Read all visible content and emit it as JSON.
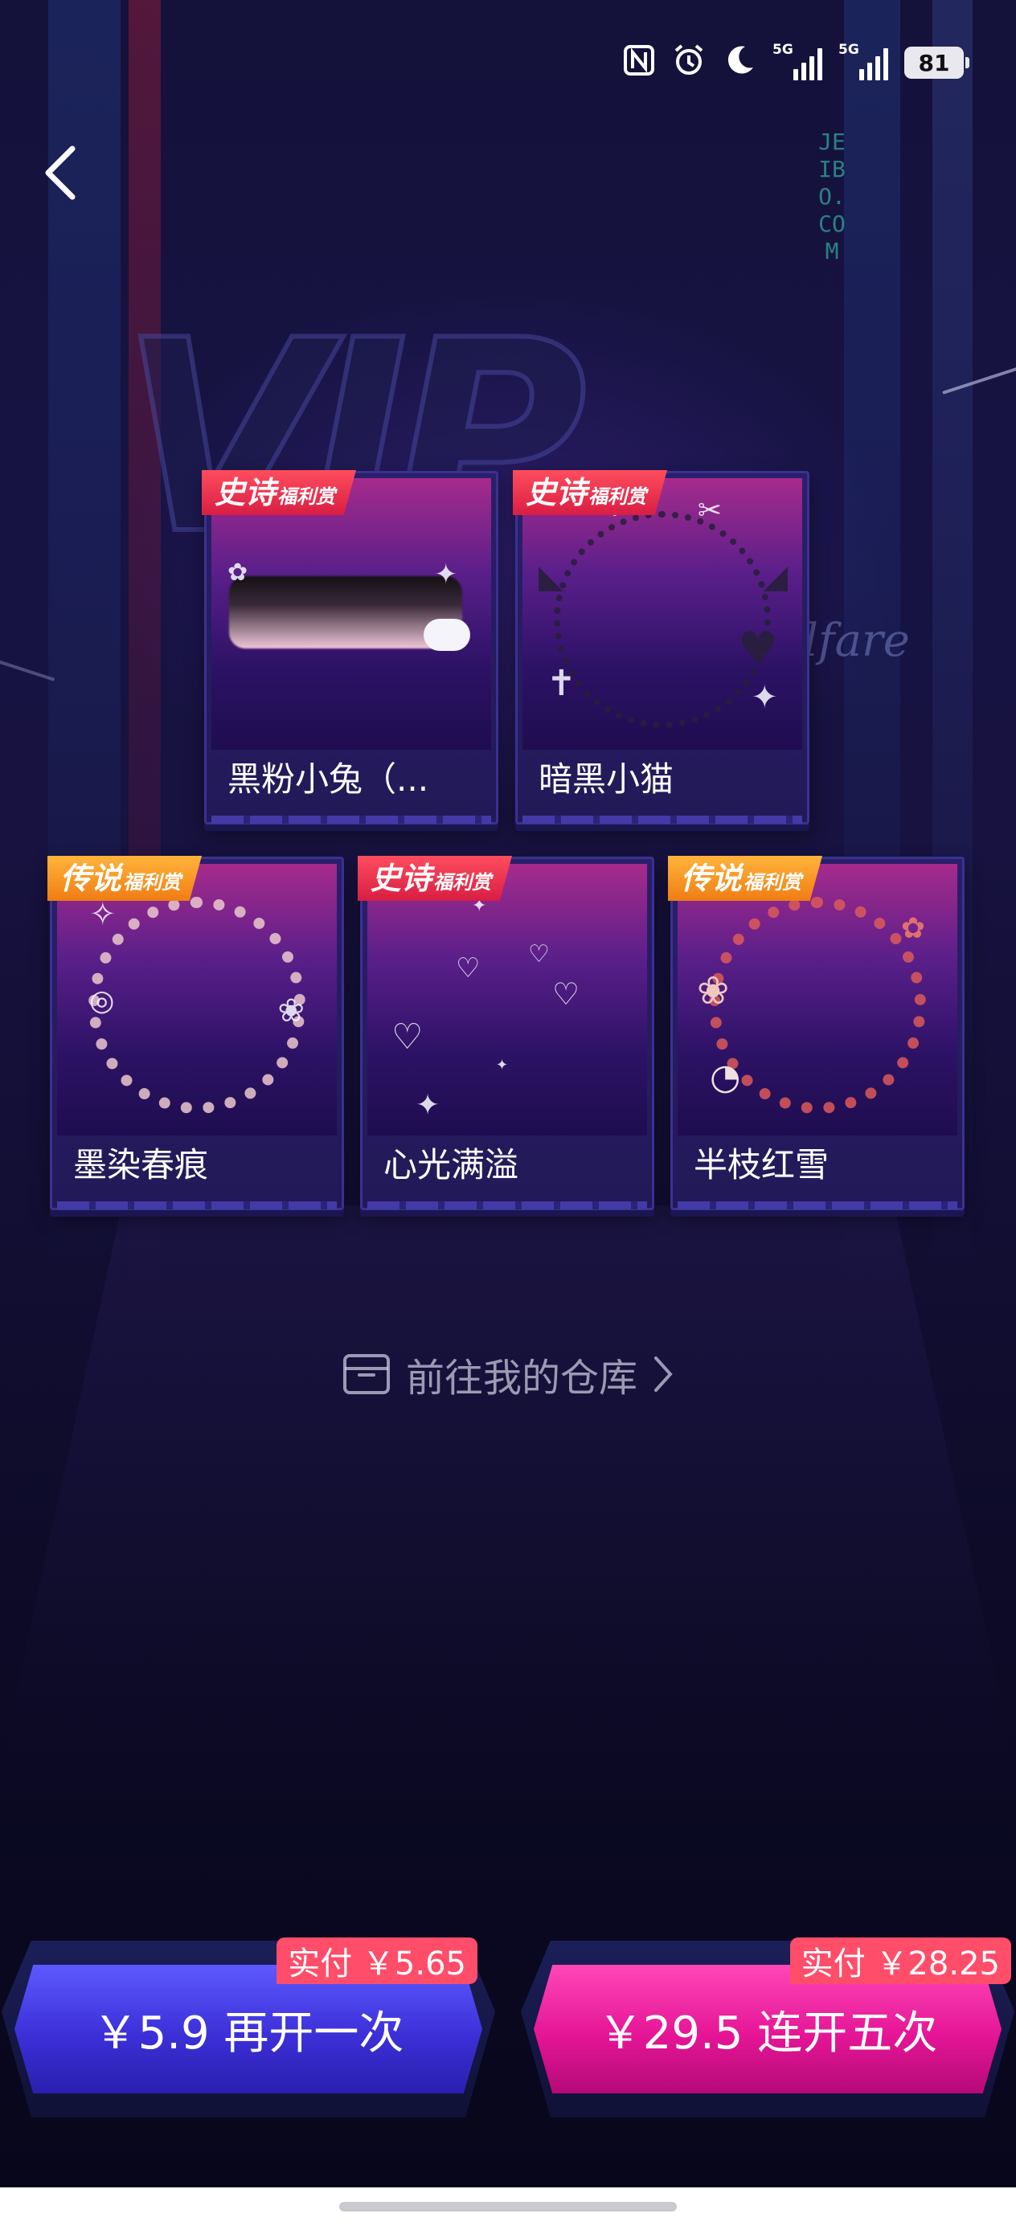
{
  "status_bar": {
    "nfc_icon": "nfc-icon",
    "alarm_icon": "alarm-icon",
    "dnd_icon": "moon-icon",
    "signal_1_label": "5G",
    "signal_2_label": "5G",
    "battery_level": "81"
  },
  "nav": {
    "back_icon": "chevron-left-icon"
  },
  "background": {
    "vertical_neon_text": "JEIBO.COM",
    "script_text": "lfare"
  },
  "rewards": [
    {
      "name": "黑粉小兔（...",
      "tier": "史诗",
      "tier_sub": "福利赏",
      "tier_color": "#e8254a"
    },
    {
      "name": "暗黑小猫",
      "tier": "史诗",
      "tier_sub": "福利赏",
      "tier_color": "#e8254a"
    },
    {
      "name": "墨染春痕",
      "tier": "传说",
      "tier_sub": "福利赏",
      "tier_color": "#f48a1c"
    },
    {
      "name": "心光满溢",
      "tier": "史诗",
      "tier_sub": "福利赏",
      "tier_color": "#e8254a"
    },
    {
      "name": "半枝红雪",
      "tier": "传说",
      "tier_sub": "福利赏",
      "tier_color": "#f48a1c"
    }
  ],
  "warehouse": {
    "label": "前往我的仓库",
    "icon": "box-icon",
    "chevron": "chevron-right-icon"
  },
  "buttons": {
    "once": {
      "label": "￥5.9 再开一次",
      "paid": "实付 ￥5.65",
      "color": "#3c2fd8"
    },
    "five": {
      "label": "￥29.5 连开五次",
      "paid": "实付 ￥28.25",
      "color": "#e51596"
    }
  }
}
